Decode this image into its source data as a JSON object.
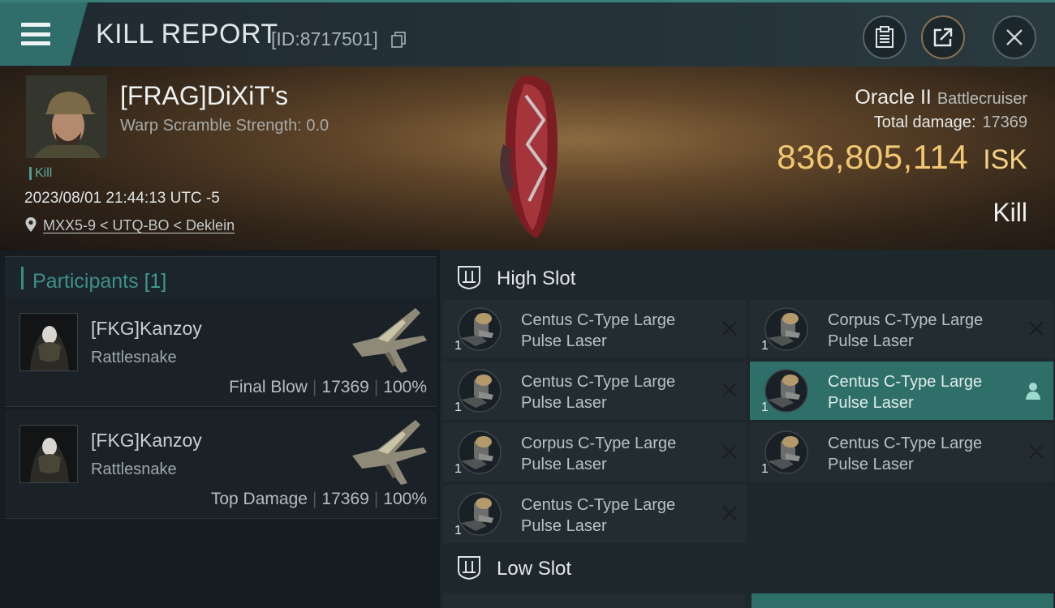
{
  "header": {
    "title": "KILL REPORT",
    "report_id": "[ID:8717501]"
  },
  "victim": {
    "name": "[FRAG]DiXiT's",
    "warp_scramble": "Warp Scramble Strength: 0.0",
    "tag": "Kill",
    "datetime": "2023/08/01 21:44:13 UTC -5",
    "location": "MXX5-9 < UTQ-BO < Deklein",
    "ship_name": "Oracle II",
    "ship_class": "Battlecruiser",
    "total_damage_label": "Total damage:",
    "total_damage": "17369",
    "isk_value": "836,805,114",
    "isk_unit": "ISK",
    "result": "Kill"
  },
  "participants": {
    "label": "Participants",
    "count": "[1]",
    "items": [
      {
        "name": "[FKG]Kanzoy",
        "ship": "Rattlesnake",
        "role": "Final Blow",
        "damage": "17369",
        "percent": "100%"
      },
      {
        "name": "[FKG]Kanzoy",
        "ship": "Rattlesnake",
        "role": "Top Damage",
        "damage": "17369",
        "percent": "100%"
      }
    ]
  },
  "fitting": {
    "high_slot_title": "High Slot",
    "low_slot_title": "Low Slot",
    "high_slot": [
      {
        "line1": "Centus C-Type Large",
        "line2": "Pulse Laser",
        "qty": "1",
        "status": "destroyed"
      },
      {
        "line1": "Corpus C-Type Large",
        "line2": "Pulse Laser",
        "qty": "1",
        "status": "destroyed"
      },
      {
        "line1": "Centus C-Type Large",
        "line2": "Pulse Laser",
        "qty": "1",
        "status": "destroyed"
      },
      {
        "line1": "Centus C-Type Large",
        "line2": "Pulse Laser",
        "qty": "1",
        "status": "dropped"
      },
      {
        "line1": "Corpus C-Type Large",
        "line2": "Pulse Laser",
        "qty": "1",
        "status": "destroyed"
      },
      {
        "line1": "Centus C-Type Large",
        "line2": "Pulse Laser",
        "qty": "1",
        "status": "destroyed"
      },
      {
        "line1": "Centus C-Type Large",
        "line2": "Pulse Laser",
        "qty": "1",
        "status": "destroyed"
      }
    ]
  },
  "colors": {
    "accent": "#3b8e88",
    "isk": "#f1c772",
    "selected_row": "#2f6f6a"
  }
}
